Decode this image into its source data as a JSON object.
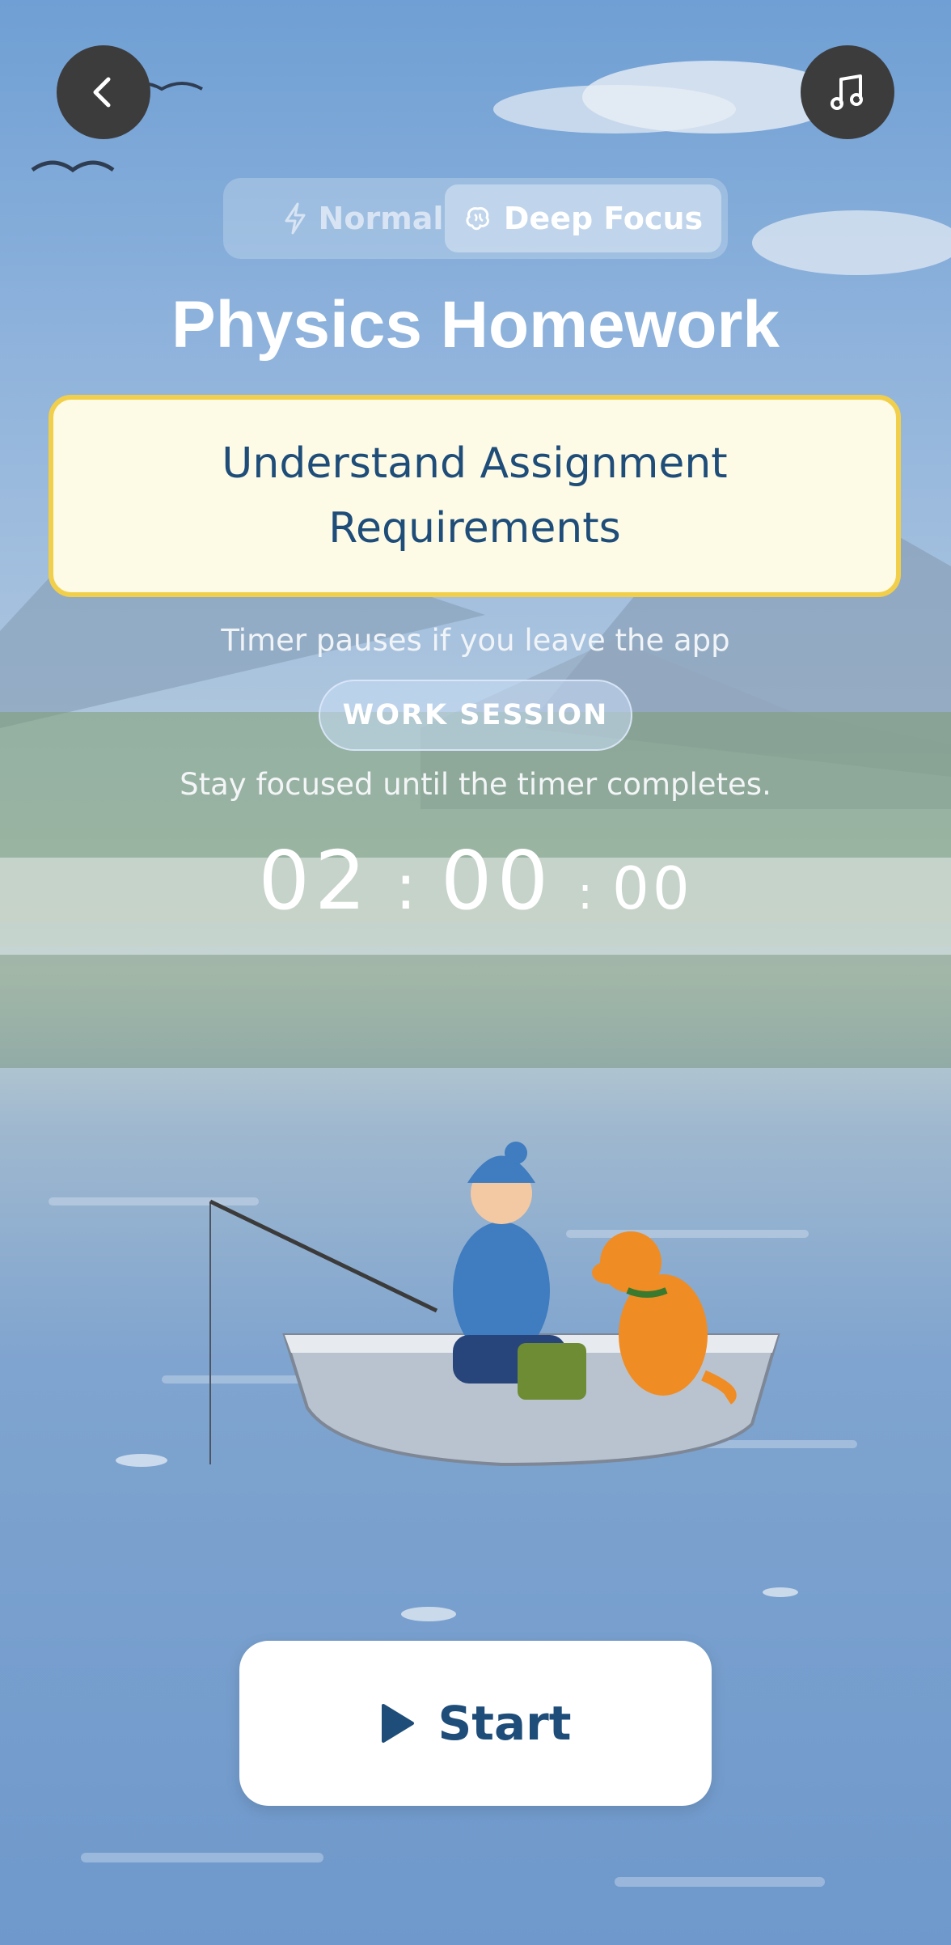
{
  "nav": {
    "back_icon": "chevron-left-icon",
    "music_icon": "music-note-icon"
  },
  "mode_toggle": {
    "options": [
      {
        "label": "Normal",
        "icon": "bolt-icon",
        "selected": false
      },
      {
        "label": "Deep Focus",
        "icon": "brain-icon",
        "selected": true
      }
    ]
  },
  "session": {
    "title": "Physics Homework",
    "task": "Understand Assignment Requirements",
    "pause_hint": "Timer pauses if you leave the app",
    "badge": "WORK SESSION",
    "subtitle": "Stay focused until the timer completes."
  },
  "timer": {
    "hours": "02",
    "minutes": "00",
    "seconds": "00",
    "separator": ":"
  },
  "start_button": {
    "label": "Start",
    "icon": "play-icon"
  },
  "illustration": {
    "name": "lake-fishing-scene",
    "subjects": [
      "fisher-in-boat",
      "dog"
    ]
  },
  "colors": {
    "accent": "#1f4d79",
    "task_border": "#f2cf4a",
    "task_bg": "#fdfbe6"
  }
}
